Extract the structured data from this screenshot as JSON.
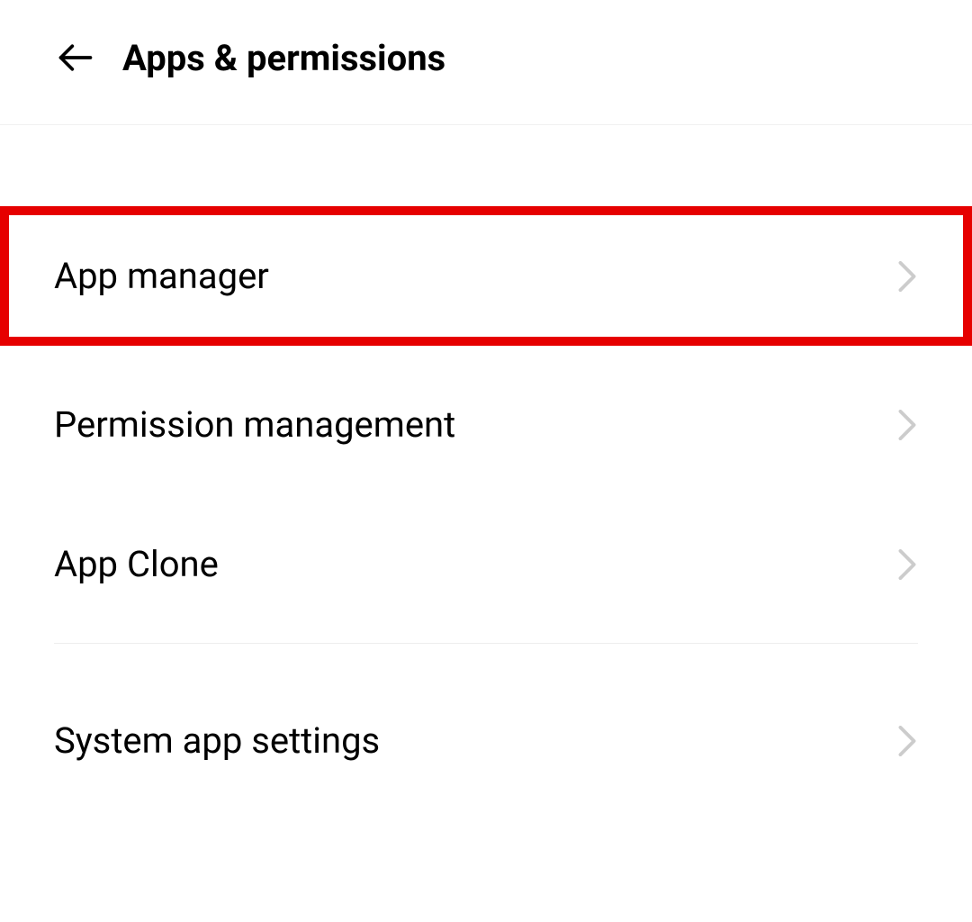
{
  "header": {
    "title": "Apps & permissions"
  },
  "items": [
    {
      "label": "App manager",
      "highlighted": true
    },
    {
      "label": "Permission management",
      "highlighted": false
    },
    {
      "label": "App Clone",
      "highlighted": false
    },
    {
      "label": "System app settings",
      "highlighted": false
    }
  ],
  "highlight_color": "#e60000"
}
